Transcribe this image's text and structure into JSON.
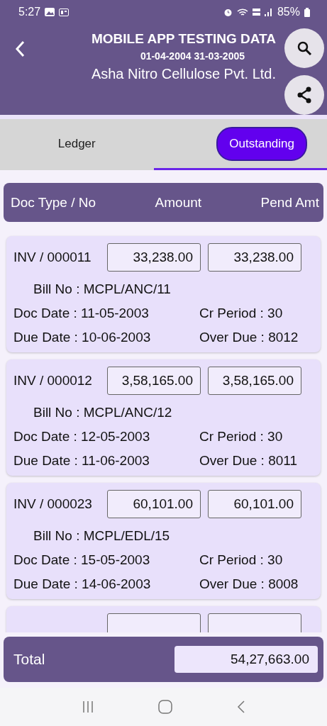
{
  "status_bar": {
    "time": "5:27",
    "battery": "85%"
  },
  "header": {
    "title": "MOBILE APP TESTING DATA",
    "period": "01-04-2004 31-03-2005",
    "company": "Asha Nitro Cellulose Pvt. Ltd."
  },
  "tabs": [
    {
      "label": "Ledger",
      "selected": false
    },
    {
      "label": "Outstanding",
      "selected": true
    }
  ],
  "table": {
    "columns": [
      "Doc Type / No",
      "Amount",
      "Pend Amt"
    ],
    "rows": [
      {
        "doc": "INV / 000011",
        "amount": "33,238.00",
        "pending": "33,238.00",
        "bill_no": "Bill No : MCPL/ANC/11",
        "doc_date": "Doc Date : 11-05-2003",
        "cr_period": "Cr Period : 30",
        "due_date": "Due Date : 10-06-2003",
        "over_due": "Over Due : 8012"
      },
      {
        "doc": "INV / 000012",
        "amount": "3,58,165.00",
        "pending": "3,58,165.00",
        "bill_no": "Bill No : MCPL/ANC/12",
        "doc_date": "Doc Date : 12-05-2003",
        "cr_period": "Cr Period : 30",
        "due_date": "Due Date : 11-06-2003",
        "over_due": "Over Due : 8011"
      },
      {
        "doc": "INV / 000023",
        "amount": "60,101.00",
        "pending": "60,101.00",
        "bill_no": "Bill No : MCPL/EDL/15",
        "doc_date": "Doc Date : 15-05-2003",
        "cr_period": "Cr Period : 30",
        "due_date": "Due Date : 14-06-2003",
        "over_due": "Over Due : 8008"
      }
    ]
  },
  "total": {
    "label": "Total",
    "value": "54,27,663.00"
  }
}
